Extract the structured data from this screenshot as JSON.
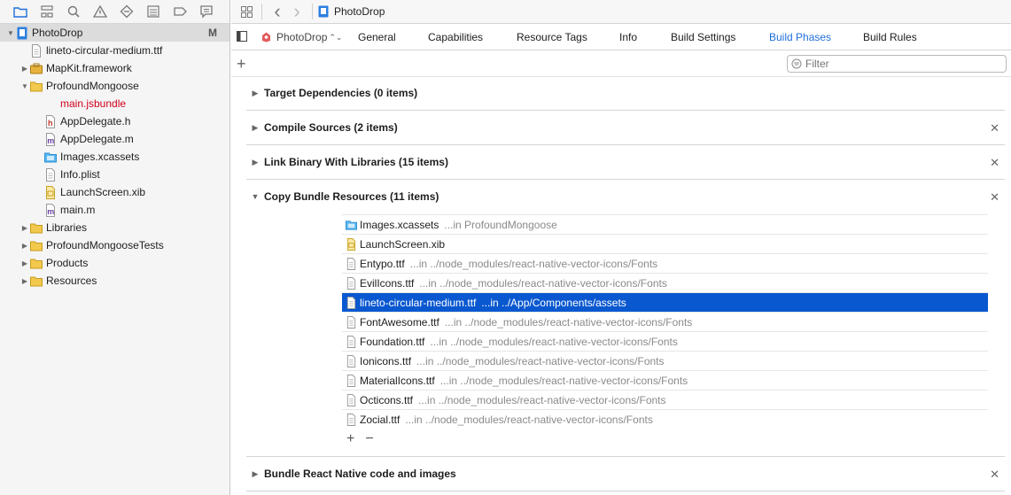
{
  "navigator": {
    "tools": [
      "folder-icon",
      "hierarchy-icon",
      "search-icon",
      "warning-icon",
      "diamond-icon",
      "list-icon",
      "tag-icon",
      "comment-icon"
    ],
    "items": [
      {
        "label": "PhotoDrop",
        "badge": "M",
        "level": 0,
        "disclosure": "open",
        "icon": "project-icon",
        "selected": true
      },
      {
        "label": "lineto-circular-medium.ttf",
        "level": 1,
        "disclosure": "",
        "icon": "file-icon"
      },
      {
        "label": "MapKit.framework",
        "level": 1,
        "disclosure": "closed",
        "icon": "toolbox-icon"
      },
      {
        "label": "ProfoundMongoose",
        "level": 1,
        "disclosure": "open",
        "icon": "folder-icon"
      },
      {
        "label": "main.jsbundle",
        "level": 2,
        "disclosure": "",
        "icon": "none",
        "red": true
      },
      {
        "label": "AppDelegate.h",
        "level": 2,
        "disclosure": "",
        "icon": "header-icon"
      },
      {
        "label": "AppDelegate.m",
        "level": 2,
        "disclosure": "",
        "icon": "objc-icon"
      },
      {
        "label": "Images.xcassets",
        "level": 2,
        "disclosure": "",
        "icon": "assets-icon"
      },
      {
        "label": "Info.plist",
        "level": 2,
        "disclosure": "",
        "icon": "file-icon"
      },
      {
        "label": "LaunchScreen.xib",
        "level": 2,
        "disclosure": "",
        "icon": "xib-icon"
      },
      {
        "label": "main.m",
        "level": 2,
        "disclosure": "",
        "icon": "objc-icon"
      },
      {
        "label": "Libraries",
        "level": 1,
        "disclosure": "closed",
        "icon": "folder-icon"
      },
      {
        "label": "ProfoundMongooseTests",
        "level": 1,
        "disclosure": "closed",
        "icon": "folder-icon"
      },
      {
        "label": "Products",
        "level": 1,
        "disclosure": "closed",
        "icon": "folder-icon"
      },
      {
        "label": "Resources",
        "level": 1,
        "disclosure": "closed",
        "icon": "folder-icon"
      }
    ]
  },
  "jump_bar": {
    "title": "PhotoDrop",
    "back": "‹",
    "forward": "›"
  },
  "target": {
    "name": "PhotoDrop"
  },
  "tabs": [
    {
      "label": "General",
      "active": false
    },
    {
      "label": "Capabilities",
      "active": false
    },
    {
      "label": "Resource Tags",
      "active": false
    },
    {
      "label": "Info",
      "active": false
    },
    {
      "label": "Build Settings",
      "active": false
    },
    {
      "label": "Build Phases",
      "active": true
    },
    {
      "label": "Build Rules",
      "active": false
    }
  ],
  "filter": {
    "placeholder": "Filter"
  },
  "phases": [
    {
      "title": "Target Dependencies (0 items)",
      "expanded": false,
      "closable": false
    },
    {
      "title": "Compile Sources (2 items)",
      "expanded": false,
      "closable": true
    },
    {
      "title": "Link Binary With Libraries (15 items)",
      "expanded": false,
      "closable": true
    },
    {
      "title": "Copy Bundle Resources (11 items)",
      "expanded": true,
      "closable": true
    },
    {
      "title": "Bundle React Native code and images",
      "expanded": false,
      "closable": true
    }
  ],
  "copy_bundle_files": [
    {
      "name": "Images.xcassets",
      "path": "...in ProfoundMongoose",
      "icon": "assets-icon"
    },
    {
      "name": "LaunchScreen.xib",
      "path": "",
      "icon": "xib-icon"
    },
    {
      "name": "Entypo.ttf",
      "path": "...in ../node_modules/react-native-vector-icons/Fonts",
      "icon": "file-icon"
    },
    {
      "name": "EvilIcons.ttf",
      "path": "...in ../node_modules/react-native-vector-icons/Fonts",
      "icon": "file-icon"
    },
    {
      "name": "lineto-circular-medium.ttf",
      "path": "...in ../App/Components/assets",
      "icon": "file-icon",
      "selected": true
    },
    {
      "name": "FontAwesome.ttf",
      "path": "...in ../node_modules/react-native-vector-icons/Fonts",
      "icon": "file-icon"
    },
    {
      "name": "Foundation.ttf",
      "path": "...in ../node_modules/react-native-vector-icons/Fonts",
      "icon": "file-icon"
    },
    {
      "name": "Ionicons.ttf",
      "path": "...in ../node_modules/react-native-vector-icons/Fonts",
      "icon": "file-icon"
    },
    {
      "name": "MaterialIcons.ttf",
      "path": "...in ../node_modules/react-native-vector-icons/Fonts",
      "icon": "file-icon"
    },
    {
      "name": "Octicons.ttf",
      "path": "...in ../node_modules/react-native-vector-icons/Fonts",
      "icon": "file-icon"
    },
    {
      "name": "Zocial.ttf",
      "path": "...in ../node_modules/react-native-vector-icons/Fonts",
      "icon": "file-icon"
    }
  ],
  "list_controls": {
    "add": "+",
    "remove": "−"
  },
  "colors": {
    "accent": "#1f6fdb",
    "selection": "#0a58d0",
    "folder": "#f2c94c",
    "error_text": "#d0021b"
  }
}
